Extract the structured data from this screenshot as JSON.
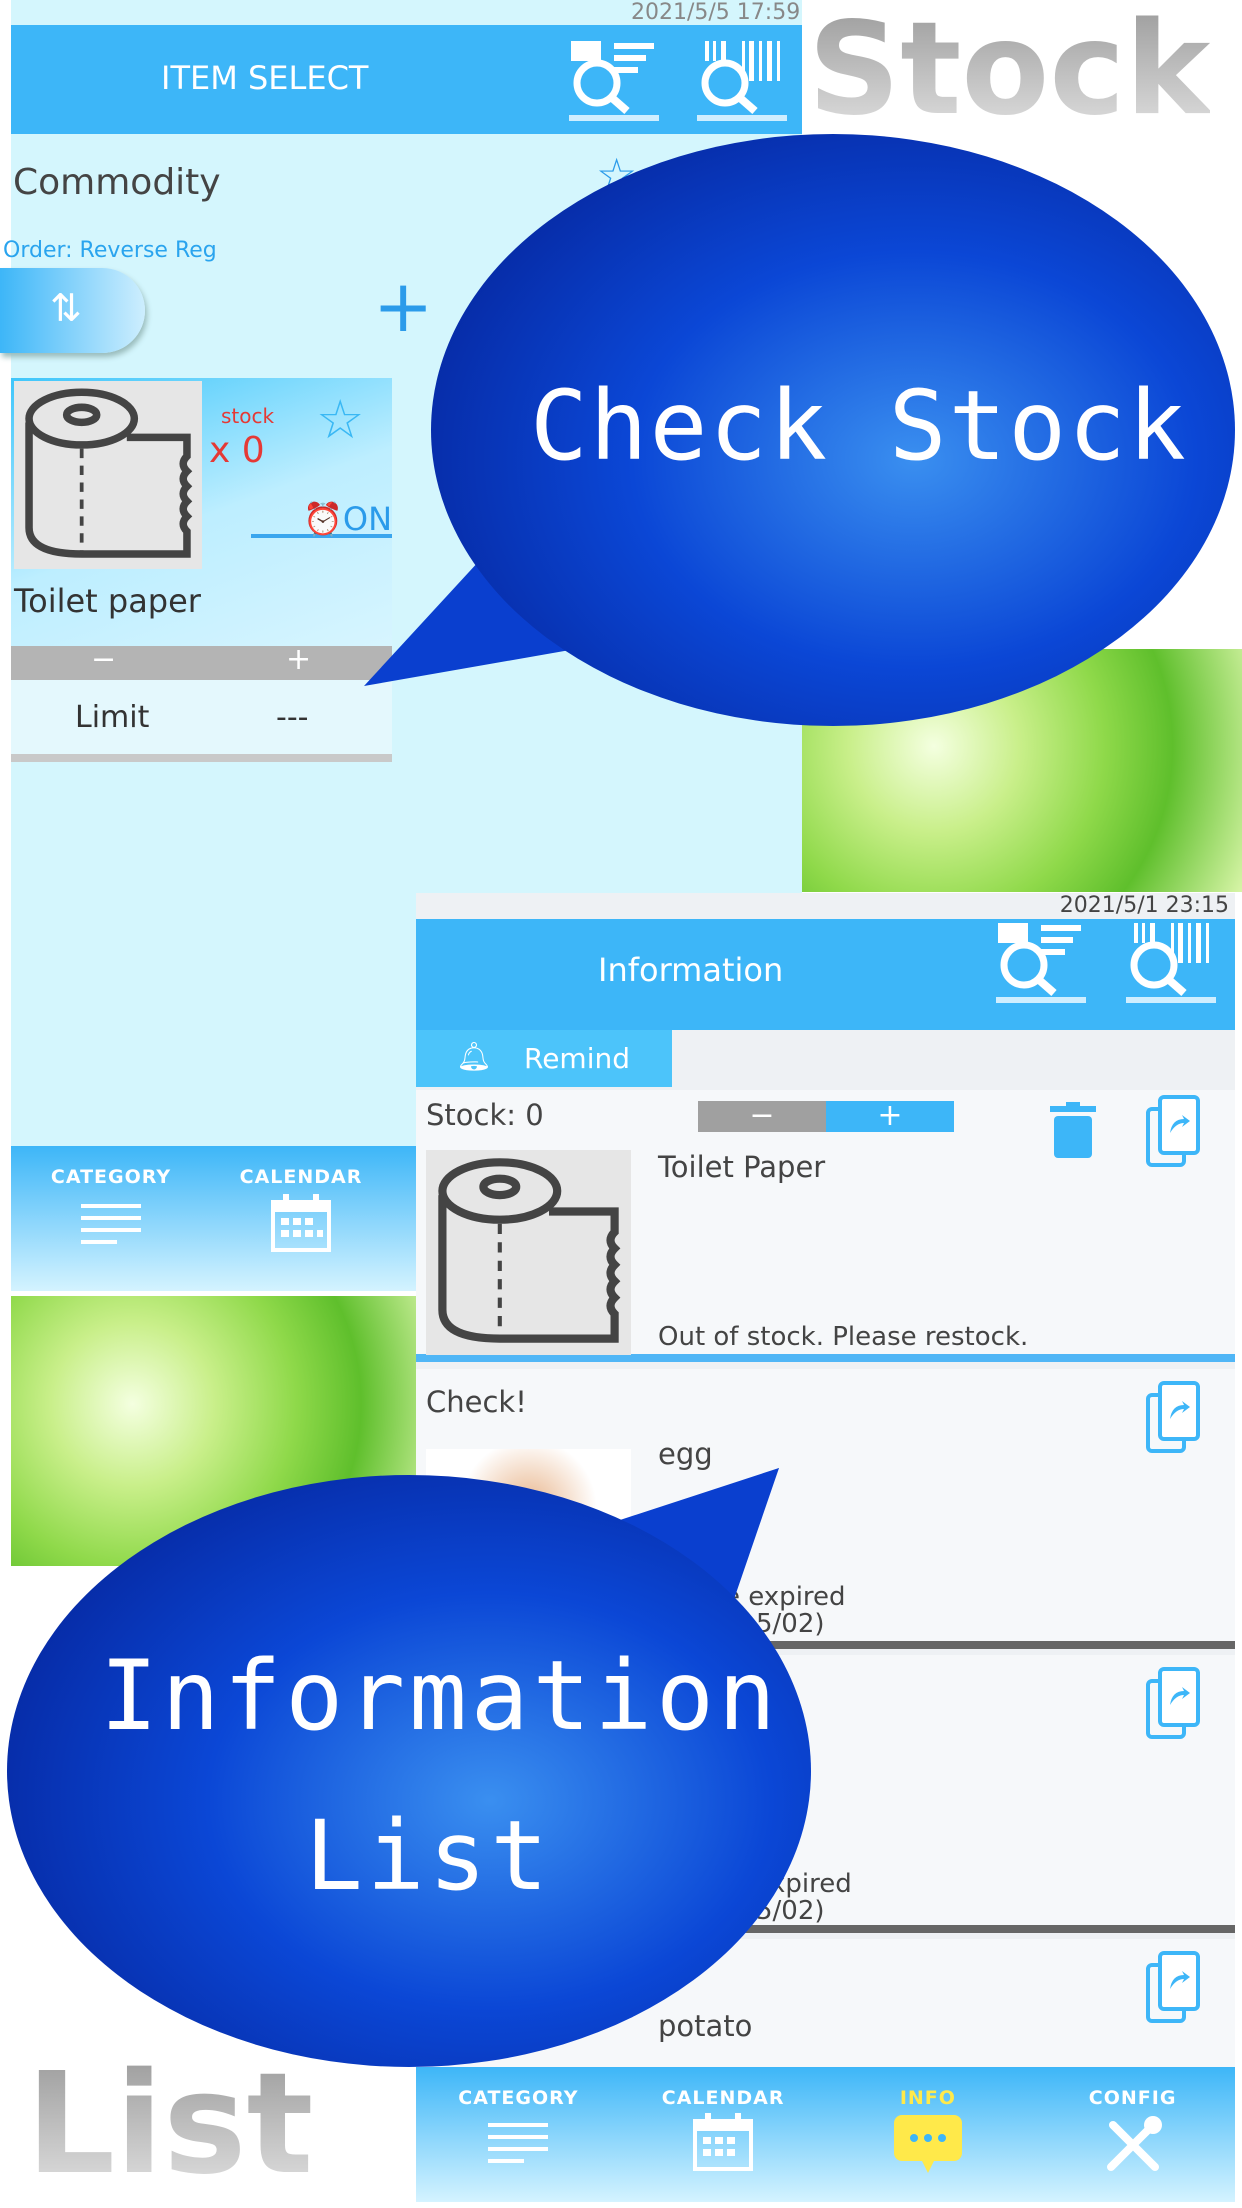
{
  "colors": {
    "accent": "#3db6f8",
    "alert": "#e53935",
    "info_active": "#ffe94a",
    "bubble": "#0a3fcf"
  },
  "logos": {
    "stock": "Stock",
    "list": "List"
  },
  "bubbles": {
    "check_stock": "Check Stock",
    "info_line1": "Information",
    "info_line2": "List"
  },
  "item_select": {
    "timestamp": "2021/5/5 17:59",
    "title": "ITEM SELECT",
    "icons": [
      "search-list-icon",
      "search-barcode-icon"
    ],
    "section": "Commodity",
    "order": "Order: Reverse Reg",
    "card": {
      "stock_label": "stock",
      "stock_value": "x 0",
      "alarm": "ON",
      "name": "Toilet paper",
      "minus": "−",
      "plus": "+",
      "limit_label": "Limit",
      "limit_value": "---"
    },
    "nav": [
      {
        "label": "CATEGORY",
        "icon": "menu-icon"
      },
      {
        "label": "CALENDAR",
        "icon": "calendar-icon"
      }
    ]
  },
  "information": {
    "timestamp": "2021/5/1 23:15",
    "title": "Information",
    "tab": "Remind",
    "rows": [
      {
        "header": "Stock: 0",
        "minus": "−",
        "plus": "+",
        "name": "Toilet Paper",
        "message": "Out of stock. Please restock."
      },
      {
        "header": "Check!",
        "name": "egg",
        "message_line1": "e expired",
        "message_line2": "5/02)"
      },
      {
        "message_line1": "xpired",
        "message_line2": "5/02)"
      },
      {
        "name": "potato"
      }
    ],
    "nav": [
      {
        "label": "CATEGORY",
        "icon": "menu-icon"
      },
      {
        "label": "CALENDAR",
        "icon": "calendar-icon"
      },
      {
        "label": "INFO",
        "icon": "chat-icon",
        "active": true
      },
      {
        "label": "CONFIG",
        "icon": "tools-icon"
      }
    ]
  }
}
